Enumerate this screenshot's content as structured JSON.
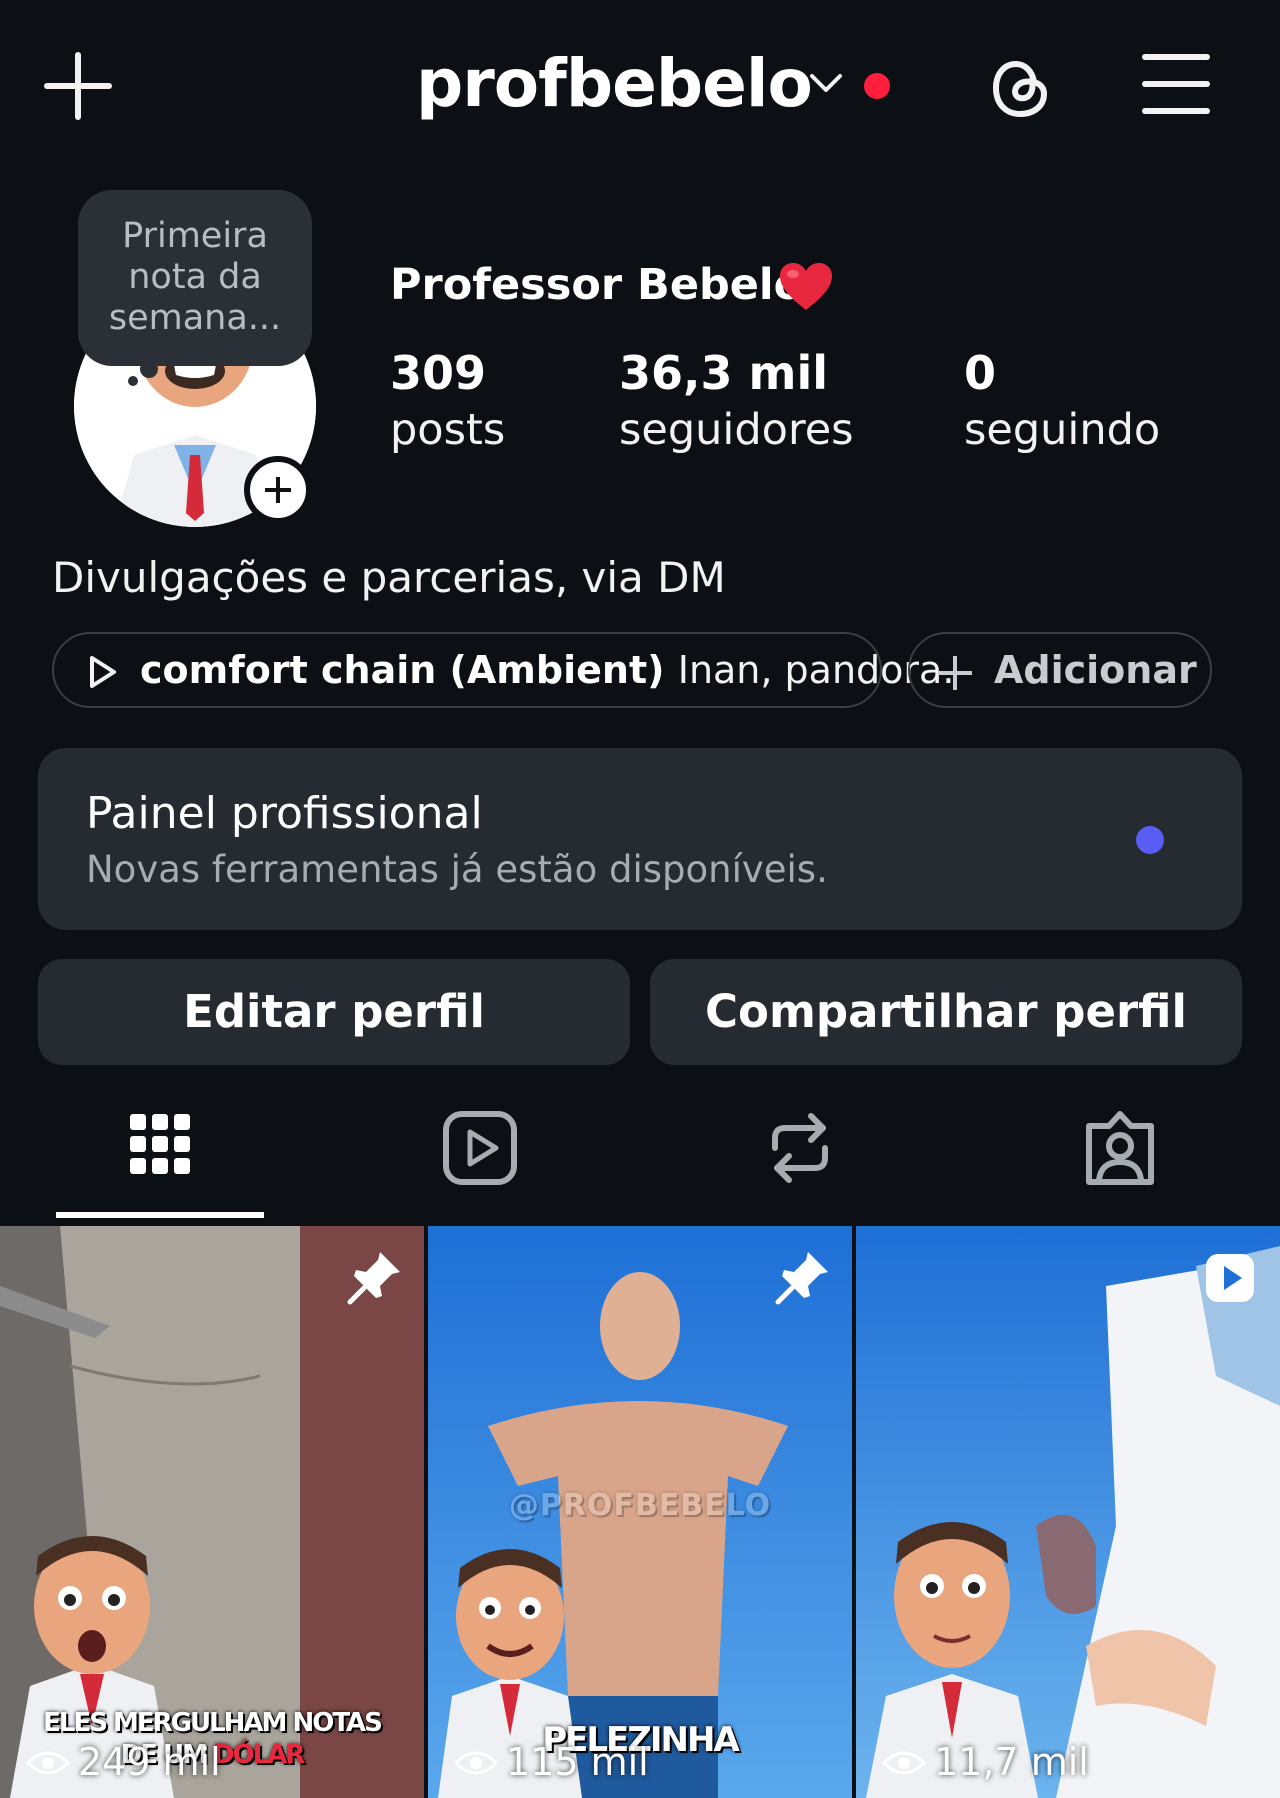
{
  "header": {
    "username": "profbebelo",
    "icons": [
      "plus-icon",
      "chevron-down-icon",
      "threads-icon",
      "hamburger-menu-icon"
    ],
    "notification_dot_color": "#ff1f3d"
  },
  "profile": {
    "note_lines": [
      "Primeira",
      "nota da",
      "semana..."
    ],
    "display_name": "Professor Bebelo",
    "stats": [
      {
        "value": "309",
        "label": "posts"
      },
      {
        "value": "36,3 mil",
        "label": "seguidores"
      },
      {
        "value": "0",
        "label": "seguindo"
      }
    ],
    "bio": "Divulgações e parcerias, via DM",
    "music": {
      "song": "comfort chain (Ambient)",
      "artist": "Inan, pandora."
    },
    "add_label": "Adicionar"
  },
  "pro_panel": {
    "title": "Painel profissional",
    "subtitle": "Novas ferramentas já estão disponíveis.",
    "dot_color": "#5b5ef5"
  },
  "actions": {
    "edit": "Editar perfil",
    "share": "Compartilhar perfil"
  },
  "tabs": [
    {
      "name": "grid-icon",
      "active": true
    },
    {
      "name": "reels-icon",
      "active": false
    },
    {
      "name": "reposts-icon",
      "active": false
    },
    {
      "name": "tagged-icon",
      "active": false
    }
  ],
  "posts": [
    {
      "views": "249 mil",
      "caption_line1": "ELES MERGULHAM NOTAS",
      "caption_line2": "DE UM",
      "caption_highlight": "DÓLAR",
      "badge": "pin-icon"
    },
    {
      "views": "115 mil",
      "caption_line1": "PELEZINHA",
      "watermark": "@PROFBEBELO",
      "badge": "pin-icon"
    },
    {
      "views": "11,7 mil",
      "badge": "reel-icon"
    }
  ]
}
